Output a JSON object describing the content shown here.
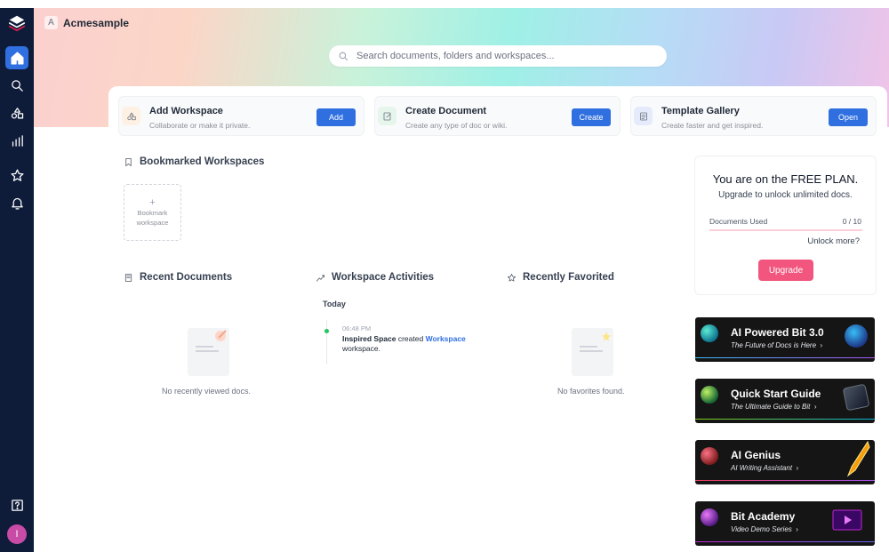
{
  "workspace": {
    "badge": "A",
    "name": "Acmesample"
  },
  "search": {
    "placeholder": "Search documents, folders and workspaces..."
  },
  "sidebar": {
    "items": [
      {
        "name": "home",
        "icon": "home-icon",
        "active": true
      },
      {
        "name": "search",
        "icon": "search-icon"
      },
      {
        "name": "workspaces",
        "icon": "shapes-icon"
      },
      {
        "name": "analytics",
        "icon": "bar-chart-icon"
      },
      {
        "name": "favorites",
        "icon": "star-icon"
      },
      {
        "name": "notifications",
        "icon": "bell-icon"
      },
      {
        "name": "help",
        "icon": "help-icon"
      }
    ],
    "avatar": "I"
  },
  "actions": [
    {
      "title": "Add Workspace",
      "subtitle": "Collaborate or make it private.",
      "button": "Add",
      "icon": "shapes-icon",
      "icon_bg": "#fdf1e4",
      "icon_color": "#6b7280"
    },
    {
      "title": "Create Document",
      "subtitle": "Create any type of doc or wiki.",
      "button": "Create",
      "icon": "edit-doc-icon",
      "icon_bg": "#e6f6ec",
      "icon_color": "#6b7280"
    },
    {
      "title": "Template Gallery",
      "subtitle": "Create faster and get inspired.",
      "button": "Open",
      "icon": "template-icon",
      "icon_bg": "#e5ebfb",
      "icon_color": "#6b7280"
    }
  ],
  "bookmarked": {
    "title": "Bookmarked Workspaces",
    "add_plus": "+",
    "add_label": "Bookmark workspace"
  },
  "recent_docs": {
    "title": "Recent Documents",
    "empty": "No recently viewed docs."
  },
  "activities": {
    "title": "Workspace Activities",
    "day": "Today",
    "items": [
      {
        "time": "06:48 PM",
        "actor": "Inspired Space",
        "verb": "created",
        "target": "Workspace",
        "suffix": "workspace."
      }
    ]
  },
  "favorites": {
    "title": "Recently Favorited",
    "empty": "No favorites found."
  },
  "plan": {
    "title": "You are on the FREE PLAN.",
    "subtitle": "Upgrade to unlock unlimited docs.",
    "used_label": "Documents Used",
    "used_count": "0 / 10",
    "used_fraction": 0,
    "more": "Unlock more?",
    "button": "Upgrade"
  },
  "promos": [
    {
      "title": "AI Powered Bit 3.0",
      "subtitle": "The Future of Docs is Here",
      "chevron": "›",
      "stripe": "#38bdf8"
    },
    {
      "title": "Quick Start Guide",
      "subtitle": "The Ultimate Guide to Bit",
      "chevron": "›",
      "stripe": "#84cc16"
    },
    {
      "title": "AI Genius",
      "subtitle": "AI Writing Assistant",
      "chevron": "›",
      "stripe": "#f43f5e"
    },
    {
      "title": "Bit Academy",
      "subtitle": "Video Demo Series",
      "chevron": "›",
      "stripe": "#c026d3"
    }
  ]
}
